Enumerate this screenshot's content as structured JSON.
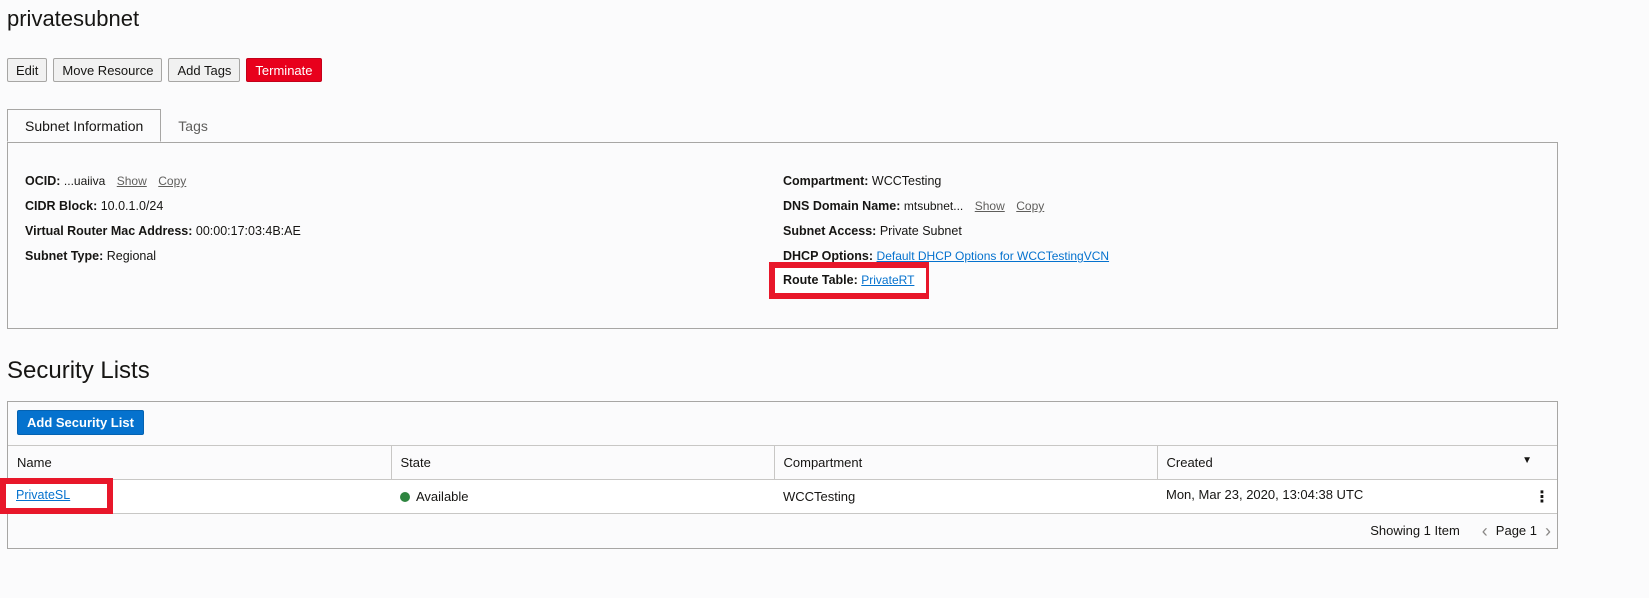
{
  "page": {
    "title": "privatesubnet"
  },
  "actions": {
    "edit": "Edit",
    "move": "Move Resource",
    "add_tags": "Add Tags",
    "terminate": "Terminate"
  },
  "tabs": [
    {
      "label": "Subnet Information",
      "active": true
    },
    {
      "label": "Tags",
      "active": false
    }
  ],
  "info": {
    "ocid_label": "OCID:",
    "ocid_value": "...uaiiva",
    "show": "Show",
    "copy": "Copy",
    "cidr_label": "CIDR Block:",
    "cidr_value": "10.0.1.0/24",
    "vr_mac_label": "Virtual Router Mac Address:",
    "vr_mac_value": "00:00:17:03:4B:AE",
    "subnet_type_label": "Subnet Type:",
    "subnet_type_value": "Regional",
    "compartment_label": "Compartment:",
    "compartment_value": "WCCTesting",
    "dns_label": "DNS Domain Name:",
    "dns_value": "mtsubnet...",
    "access_label": "Subnet Access:",
    "access_value": "Private Subnet",
    "dhcp_label": "DHCP Options:",
    "dhcp_value": "Default DHCP Options for WCCTestingVCN",
    "route_label": "Route Table:",
    "route_value": "PrivateRT"
  },
  "security_lists": {
    "title": "Security Lists",
    "add_button": "Add Security List",
    "columns": [
      "Name",
      "State",
      "Compartment",
      "Created"
    ],
    "rows": [
      {
        "name": "PrivateSL",
        "state": "Available",
        "compartment": "WCCTesting",
        "created": "Mon, Mar 23, 2020, 13:04:38 UTC"
      }
    ],
    "showing": "Showing 1 Item",
    "page": "Page 1"
  },
  "colors": {
    "terminate": "#e8001c",
    "primary": "#0572ce",
    "available": "#2e8540",
    "highlight": "#e8172a"
  }
}
